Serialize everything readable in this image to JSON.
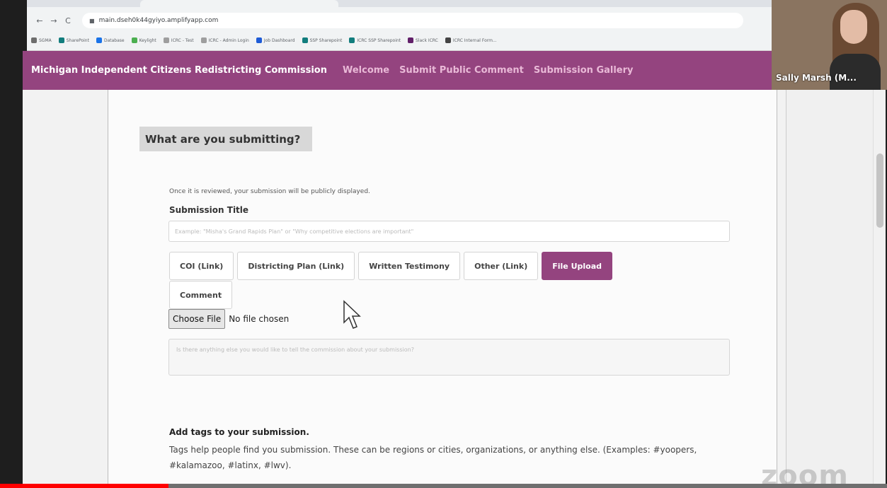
{
  "browser": {
    "url": "main.dseh0k44gyiyo.amplifyapp.com",
    "bookmarks": [
      {
        "label": "SGMA",
        "color": "#6d6d6d"
      },
      {
        "label": "SharePoint",
        "color": "#127d7d"
      },
      {
        "label": "Database",
        "color": "#1a73e8"
      },
      {
        "label": "Keylight",
        "color": "#4caf50"
      },
      {
        "label": "ICRC - Test",
        "color": "#9e9e9e"
      },
      {
        "label": "ICRC - Admin Login",
        "color": "#9e9e9e"
      },
      {
        "label": "Job Dashboard",
        "color": "#1e5bd6"
      },
      {
        "label": "SSP Sharepoint",
        "color": "#127d7d"
      },
      {
        "label": "ICRC SSP Sharepoint",
        "color": "#127d7d"
      },
      {
        "label": "Slack ICRC",
        "color": "#611f69"
      },
      {
        "label": "ICRC Internal Form...",
        "color": "#444444"
      }
    ]
  },
  "header": {
    "title": "Michigan Independent Citizens Redistricting Commission",
    "nav": [
      "Welcome",
      "Submit Public Comment",
      "Submission Gallery"
    ]
  },
  "form": {
    "section_heading": "What are you submitting?",
    "notice": "Once it is reviewed, your submission will be publicly displayed.",
    "title_label": "Submission Title",
    "title_placeholder": "Example: \"Misha's Grand Rapids Plan\" or \"Why competitive elections are important\"",
    "tabs": [
      {
        "label": "COI (Link)",
        "active": false
      },
      {
        "label": "Districting Plan (Link)",
        "active": false
      },
      {
        "label": "Written Testimony",
        "active": false
      },
      {
        "label": "Other (Link)",
        "active": false
      },
      {
        "label": "File Upload",
        "active": true
      },
      {
        "label": "Comment",
        "active": false
      }
    ],
    "choose_file_label": "Choose File",
    "no_file_text": "No file chosen",
    "comment_placeholder": "Is there anything else you would like to tell the commission about your submission?",
    "tags_heading": "Add tags to your submission.",
    "tags_help": "Tags help people find you submission. These can be regions or cities, organizations, or anything else. (Examples: #yoopers, #kalamazoo, #latinx, #lwv)."
  },
  "video": {
    "participant_name": "Sally Marsh (M..."
  },
  "watermark": "zoom",
  "playback_progress": 0.19,
  "colors": {
    "brand": "#94447f",
    "nav_link": "#e9b9d7"
  }
}
